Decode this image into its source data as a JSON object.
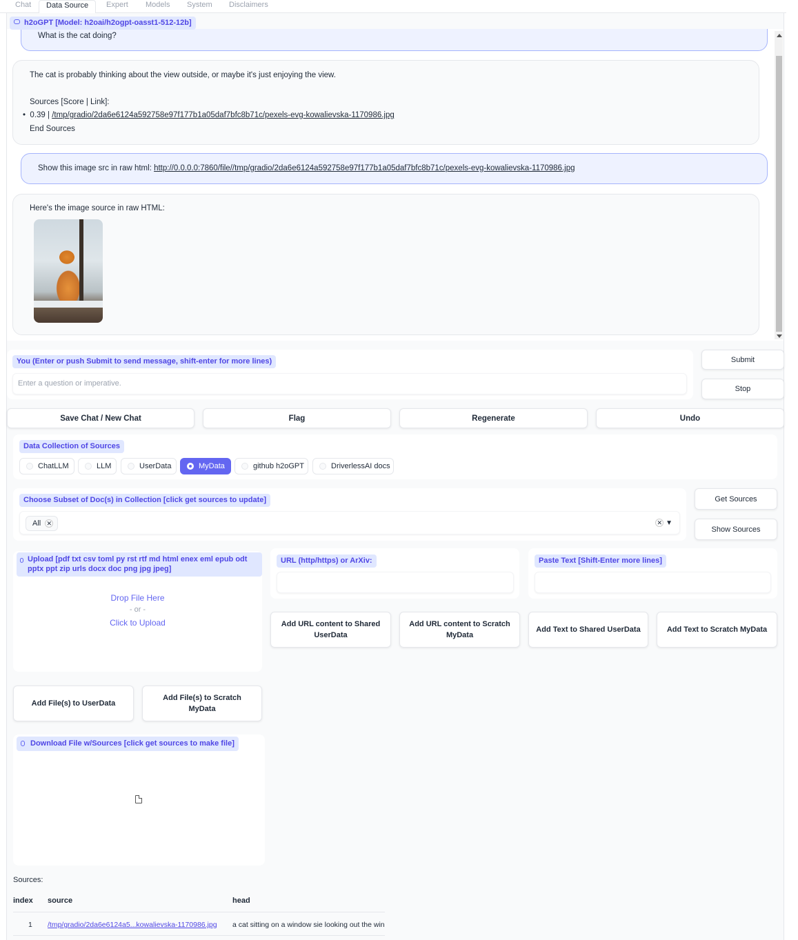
{
  "tabs": [
    "Chat",
    "Data Source",
    "Expert",
    "Models",
    "System",
    "Disclaimers"
  ],
  "model_label": "h2oGPT [Model: h2oai/h2ogpt-oasst1-512-12b]",
  "chat": {
    "user_question": "What is the cat doing?",
    "bot_answer": "The cat is probably thinking about the view outside, or maybe it's just enjoying the view.",
    "sources_header": "Sources [Score | Link]:",
    "source_score": "0.39 | ",
    "source_link": "/tmp/gradio/2da6e6124a592758e97f177b1a05daf7bfc8b71c/pexels-evg-kowalievska-1170986.jpg",
    "end_sources": "End Sources",
    "user_prompt_prefix": "Show this image src in raw html: ",
    "user_prompt_link": "http://0.0.0.0:7860/file//tmp/gradio/2da6e6124a592758e97f177b1a05daf7bfc8b71c/pexels-evg-kowalievska-1170986.jpg",
    "bot_reply": "Here's the image source in raw HTML:"
  },
  "input": {
    "label": "You (Enter or push Submit to send message, shift-enter for more lines)",
    "placeholder": "Enter a question or imperative.",
    "submit": "Submit",
    "stop": "Stop"
  },
  "actions": [
    "Save Chat / New Chat",
    "Flag",
    "Regenerate",
    "Undo"
  ],
  "collection": {
    "label": "Data Collection of Sources",
    "options": [
      "ChatLLM",
      "LLM",
      "UserData",
      "MyData",
      "github h2oGPT",
      "DriverlessAI docs"
    ],
    "selected": "MyData"
  },
  "subset": {
    "label": "Choose Subset of Doc(s) in Collection [click get sources to update]",
    "token": "All",
    "get_sources": "Get Sources",
    "show_sources": "Show Sources"
  },
  "upload": {
    "label": "Upload [pdf txt csv toml py rst rtf md html enex eml epub odt pptx ppt zip urls docx doc png jpg jpeg]",
    "drop": "Drop File Here",
    "or": "- or -",
    "click": "Click to Upload",
    "add_user": "Add File(s) to UserData",
    "add_scratch": "Add File(s) to Scratch MyData"
  },
  "url": {
    "label": "URL (http/https) or ArXiv:",
    "add_shared": "Add URL content to Shared UserData",
    "add_scratch": "Add URL content to Scratch MyData"
  },
  "paste": {
    "label": "Paste Text [Shift-Enter more lines]",
    "add_shared": "Add Text to Shared UserData",
    "add_scratch": "Add Text to Scratch MyData"
  },
  "download": {
    "label": "Download File w/Sources [click get sources to make file]"
  },
  "sources_table": {
    "title": "Sources:",
    "columns": [
      "index",
      "source",
      "head"
    ],
    "rows": [
      [
        "1",
        "/tmp/gradio/2da6e6124a5...kowalievska-1170986.jpg",
        "a cat sitting on a window sie looking out the win"
      ]
    ]
  },
  "colors": {
    "accent": "#6366f1",
    "accent_light": "#e0e7ff"
  }
}
